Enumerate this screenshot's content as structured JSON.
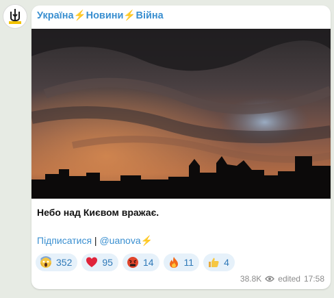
{
  "channel": {
    "title": "Україна⚡Новини⚡Війна",
    "avatar_icon": "trident-logo-icon",
    "accent_color": "#3a8fd0"
  },
  "post": {
    "caption": "Небо над Києвом вражає.",
    "subscribe_link": "Підписатися",
    "separator": " | ",
    "channel_link": "@uanova⚡",
    "reactions": [
      {
        "icon": "scream-emoji-icon",
        "count": "352"
      },
      {
        "icon": "red-heart-emoji-icon",
        "count": "95"
      },
      {
        "icon": "angry-swearing-emoji-icon",
        "count": "14"
      },
      {
        "icon": "fire-emoji-icon",
        "count": "11"
      },
      {
        "icon": "thumbs-up-emoji-icon",
        "count": "4"
      }
    ],
    "views": "38.8K",
    "edited_label": "edited",
    "time": "17:58"
  }
}
